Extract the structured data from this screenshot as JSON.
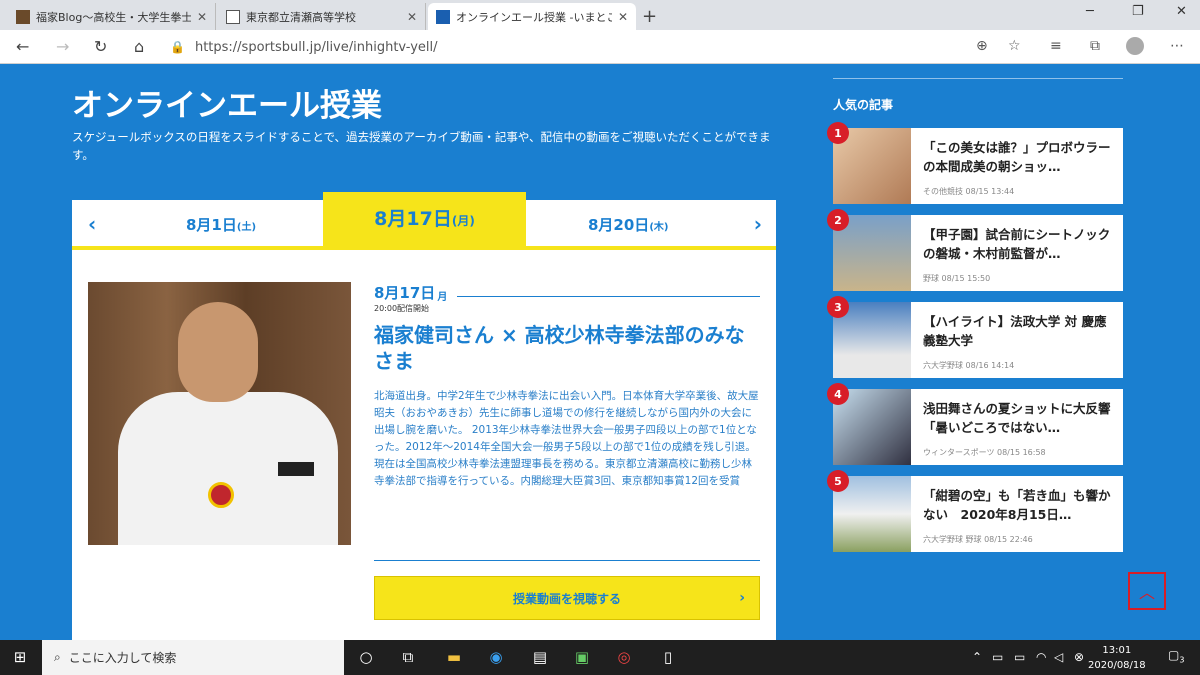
{
  "browser": {
    "tabs": [
      {
        "title": "福家Blog～高校生・大学生拳士の"
      },
      {
        "title": "東京都立清瀬高等学校"
      },
      {
        "title": "オンラインエール授業 -いまとこれから"
      }
    ],
    "url": "https://sportsbull.jp/live/inhightv-yell/"
  },
  "page": {
    "title": "オンラインエール授業",
    "description": "スケジュールボックスの日程をスライドすることで、過去授業のアーカイブ動画・記事や、配信中の動画をご視聴いただくことができます。",
    "dates": {
      "prev": {
        "day": "8月1日",
        "wd": "(土)"
      },
      "active": {
        "day": "8月17日",
        "wd": "(月)"
      },
      "next": {
        "day": "8月20日",
        "wd": "(木)"
      }
    },
    "lesson": {
      "date": "8月17日",
      "weekday": "月",
      "time": "20:00配信開始",
      "title": "福家健司さん × 高校少林寺拳法部のみなさま",
      "body": "北海道出身。中学2年生で少林寺拳法に出会い入門。日本体育大学卒業後、故大屋昭夫（おおやあきお）先生に師事し道場での修行を継続しながら国内外の大会に出場し腕を磨いた。 2013年少林寺拳法世界大会一般男子四段以上の部で1位となった。2012年～2014年全国大会一般男子5段以上の部で1位の成績を残し引退。 現在は全国高校少林寺拳法連盟理事長を務める。東京都立清瀬高校に勤務し少林寺拳法部で指導を行っている。内閣総理大臣賞3回、東京都知事賞12回を受賞",
      "watch_label": "授業動画を視聴する"
    }
  },
  "sidebar": {
    "heading": "人気の記事",
    "articles": [
      {
        "rank": "1",
        "title": "「この美女は誰？」プロボウラーの本間成美の朝ショッ…",
        "meta": "その他競技 08/15 13:44"
      },
      {
        "rank": "2",
        "title": "【甲子園】試合前にシートノックの磐城・木村前監督が…",
        "meta": "野球 08/15 15:50"
      },
      {
        "rank": "3",
        "title": "【ハイライト】法政大学 対 慶應義塾大学",
        "meta": "六大学野球 08/16 14:14"
      },
      {
        "rank": "4",
        "title": "浅田舞さんの夏ショットに大反響「暑いどころではない…",
        "meta": "ウィンタースポーツ 08/15 16:58"
      },
      {
        "rank": "5",
        "title": "「紺碧の空」も「若き血」も響かない　2020年8月15日…",
        "meta": "六大学野球 野球 08/15 22:46"
      }
    ]
  },
  "taskbar": {
    "search_placeholder": "ここに入力して検索",
    "time": "13:01",
    "date": "2020/08/18",
    "notif_count": "3"
  },
  "colors": {
    "brand_blue": "#1a7fd0",
    "accent_yellow": "#f6e41a",
    "rank_red": "#d81e28"
  }
}
